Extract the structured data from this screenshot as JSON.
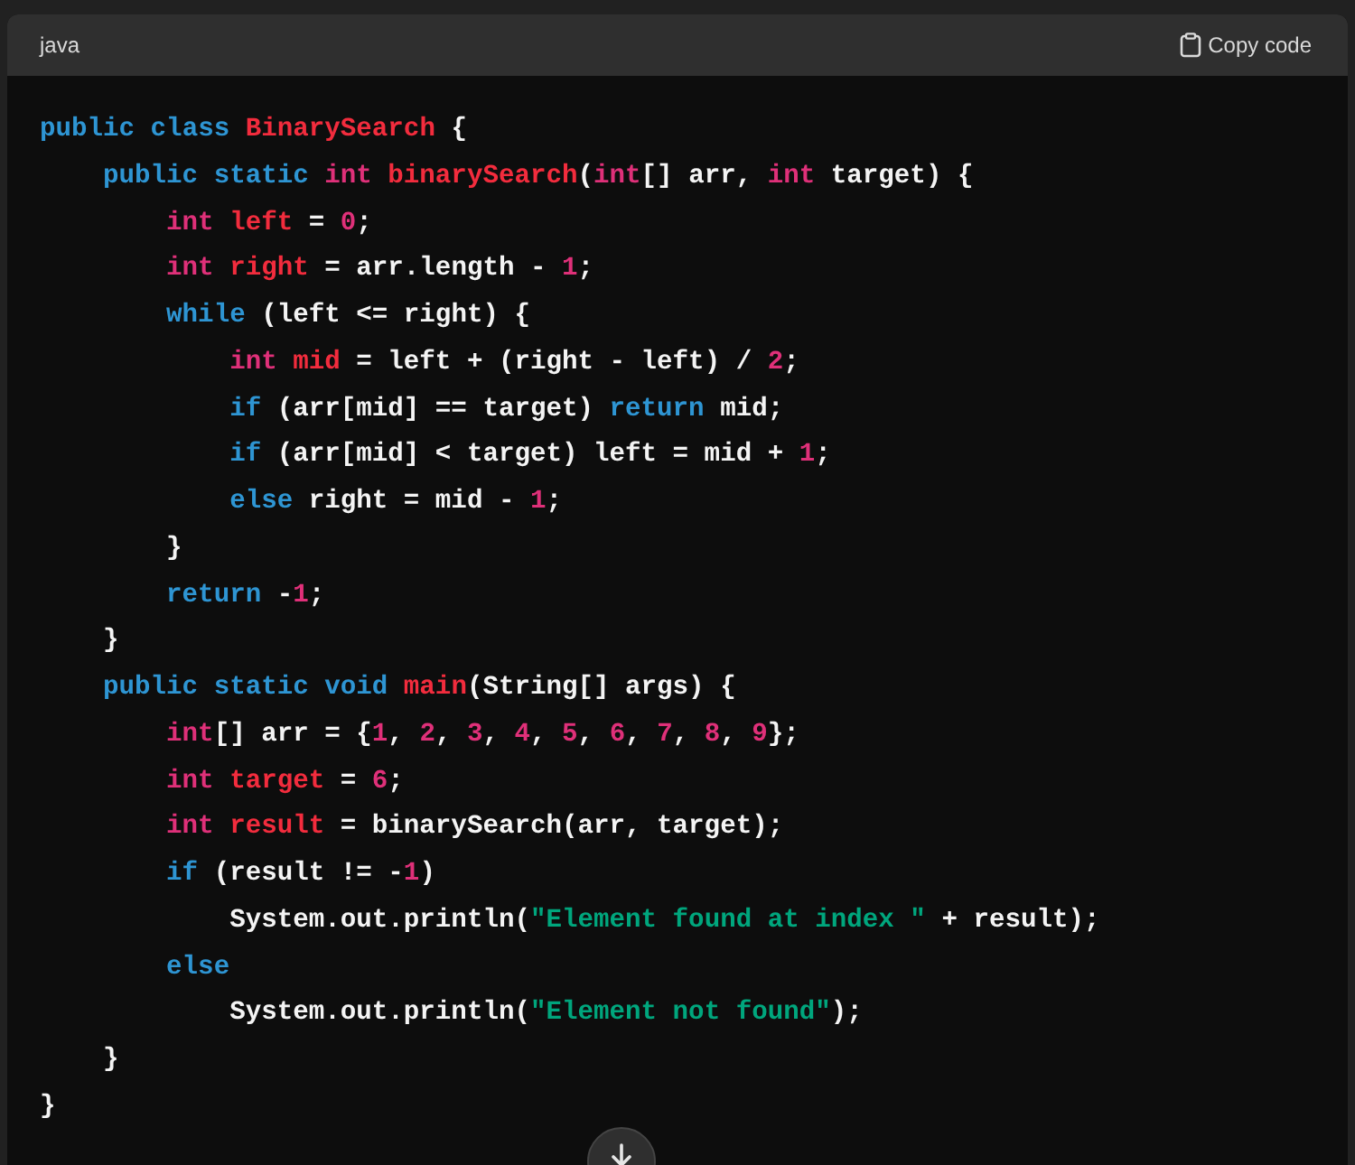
{
  "code_block": {
    "language": "java",
    "copy_label": "Copy code",
    "lines": [
      {
        "tokens": [
          {
            "kind": "kw",
            "text": "public class "
          },
          {
            "kind": "name",
            "text": "BinarySearch"
          },
          {
            "kind": "plain",
            "text": " {"
          }
        ],
        "children": [
          {
            "tokens": [
              {
                "kind": "kw",
                "text": "public static "
              },
              {
                "kind": "type",
                "text": "int "
              },
              {
                "kind": "name",
                "text": "binarySearch"
              },
              {
                "kind": "plain",
                "text": "("
              },
              {
                "kind": "type",
                "text": "int"
              },
              {
                "kind": "plain",
                "text": "[] arr, "
              },
              {
                "kind": "type",
                "text": "int"
              },
              {
                "kind": "plain",
                "text": " target) {"
              }
            ],
            "children": [
              {
                "tokens": [
                  {
                    "kind": "type",
                    "text": "int "
                  },
                  {
                    "kind": "name",
                    "text": "left"
                  },
                  {
                    "kind": "plain",
                    "text": " = "
                  },
                  {
                    "kind": "num",
                    "text": "0"
                  },
                  {
                    "kind": "plain",
                    "text": ";"
                  }
                ]
              },
              {
                "tokens": [
                  {
                    "kind": "type",
                    "text": "int "
                  },
                  {
                    "kind": "name",
                    "text": "right"
                  },
                  {
                    "kind": "plain",
                    "text": " = arr.length - "
                  },
                  {
                    "kind": "num",
                    "text": "1"
                  },
                  {
                    "kind": "plain",
                    "text": ";"
                  }
                ]
              },
              {
                "tokens": [
                  {
                    "kind": "kw",
                    "text": "while"
                  },
                  {
                    "kind": "plain",
                    "text": " (left <= right) {"
                  }
                ],
                "children": [
                  {
                    "tokens": [
                      {
                        "kind": "type",
                        "text": "int "
                      },
                      {
                        "kind": "name",
                        "text": "mid"
                      },
                      {
                        "kind": "plain",
                        "text": " = left + (right - left) / "
                      },
                      {
                        "kind": "num",
                        "text": "2"
                      },
                      {
                        "kind": "plain",
                        "text": ";"
                      }
                    ]
                  },
                  {
                    "tokens": [
                      {
                        "kind": "kw",
                        "text": "if"
                      },
                      {
                        "kind": "plain",
                        "text": " (arr[mid] == target) "
                      },
                      {
                        "kind": "kw",
                        "text": "return"
                      },
                      {
                        "kind": "plain",
                        "text": " mid;"
                      }
                    ]
                  },
                  {
                    "tokens": [
                      {
                        "kind": "kw",
                        "text": "if"
                      },
                      {
                        "kind": "plain",
                        "text": " (arr[mid] < target) left = mid + "
                      },
                      {
                        "kind": "num",
                        "text": "1"
                      },
                      {
                        "kind": "plain",
                        "text": ";"
                      }
                    ]
                  },
                  {
                    "tokens": [
                      {
                        "kind": "kw",
                        "text": "else"
                      },
                      {
                        "kind": "plain",
                        "text": " right = mid - "
                      },
                      {
                        "kind": "num",
                        "text": "1"
                      },
                      {
                        "kind": "plain",
                        "text": ";"
                      }
                    ]
                  }
                ]
              },
              {
                "tokens": [
                  {
                    "kind": "plain",
                    "text": "}"
                  }
                ]
              },
              {
                "tokens": [
                  {
                    "kind": "kw",
                    "text": "return"
                  },
                  {
                    "kind": "plain",
                    "text": " -"
                  },
                  {
                    "kind": "num",
                    "text": "1"
                  },
                  {
                    "kind": "plain",
                    "text": ";"
                  }
                ]
              }
            ]
          },
          {
            "tokens": [
              {
                "kind": "plain",
                "text": "}"
              }
            ]
          },
          {
            "tokens": [
              {
                "kind": "kw",
                "text": "public static void "
              },
              {
                "kind": "name",
                "text": "main"
              },
              {
                "kind": "plain",
                "text": "(String[] args) {"
              }
            ],
            "children": [
              {
                "tokens": [
                  {
                    "kind": "type",
                    "text": "int"
                  },
                  {
                    "kind": "plain",
                    "text": "[] arr = {"
                  },
                  {
                    "kind": "num",
                    "text": "1"
                  },
                  {
                    "kind": "plain",
                    "text": ", "
                  },
                  {
                    "kind": "num",
                    "text": "2"
                  },
                  {
                    "kind": "plain",
                    "text": ", "
                  },
                  {
                    "kind": "num",
                    "text": "3"
                  },
                  {
                    "kind": "plain",
                    "text": ", "
                  },
                  {
                    "kind": "num",
                    "text": "4"
                  },
                  {
                    "kind": "plain",
                    "text": ", "
                  },
                  {
                    "kind": "num",
                    "text": "5"
                  },
                  {
                    "kind": "plain",
                    "text": ", "
                  },
                  {
                    "kind": "num",
                    "text": "6"
                  },
                  {
                    "kind": "plain",
                    "text": ", "
                  },
                  {
                    "kind": "num",
                    "text": "7"
                  },
                  {
                    "kind": "plain",
                    "text": ", "
                  },
                  {
                    "kind": "num",
                    "text": "8"
                  },
                  {
                    "kind": "plain",
                    "text": ", "
                  },
                  {
                    "kind": "num",
                    "text": "9"
                  },
                  {
                    "kind": "plain",
                    "text": "};"
                  }
                ]
              },
              {
                "tokens": [
                  {
                    "kind": "type",
                    "text": "int "
                  },
                  {
                    "kind": "name",
                    "text": "target"
                  },
                  {
                    "kind": "plain",
                    "text": " = "
                  },
                  {
                    "kind": "num",
                    "text": "6"
                  },
                  {
                    "kind": "plain",
                    "text": ";"
                  }
                ]
              },
              {
                "tokens": [
                  {
                    "kind": "type",
                    "text": "int "
                  },
                  {
                    "kind": "name",
                    "text": "result"
                  },
                  {
                    "kind": "plain",
                    "text": " = binarySearch(arr, target);"
                  }
                ]
              },
              {
                "tokens": [
                  {
                    "kind": "kw",
                    "text": "if"
                  },
                  {
                    "kind": "plain",
                    "text": " (result != -"
                  },
                  {
                    "kind": "num",
                    "text": "1"
                  },
                  {
                    "kind": "plain",
                    "text": ")"
                  }
                ],
                "children": [
                  {
                    "tokens": [
                      {
                        "kind": "plain",
                        "text": "System.out.println("
                      },
                      {
                        "kind": "str",
                        "text": "\"Element found at index \""
                      },
                      {
                        "kind": "plain",
                        "text": " + result);"
                      }
                    ]
                  }
                ]
              },
              {
                "tokens": [
                  {
                    "kind": "kw",
                    "text": "else"
                  }
                ],
                "children": [
                  {
                    "tokens": [
                      {
                        "kind": "plain",
                        "text": "System.out.println("
                      },
                      {
                        "kind": "str",
                        "text": "\"Element not found\""
                      },
                      {
                        "kind": "plain",
                        "text": ");"
                      }
                    ]
                  }
                ]
              }
            ]
          },
          {
            "tokens": [
              {
                "kind": "plain",
                "text": "}"
              }
            ]
          }
        ]
      },
      {
        "tokens": [
          {
            "kind": "plain",
            "text": "}"
          }
        ]
      }
    ]
  }
}
